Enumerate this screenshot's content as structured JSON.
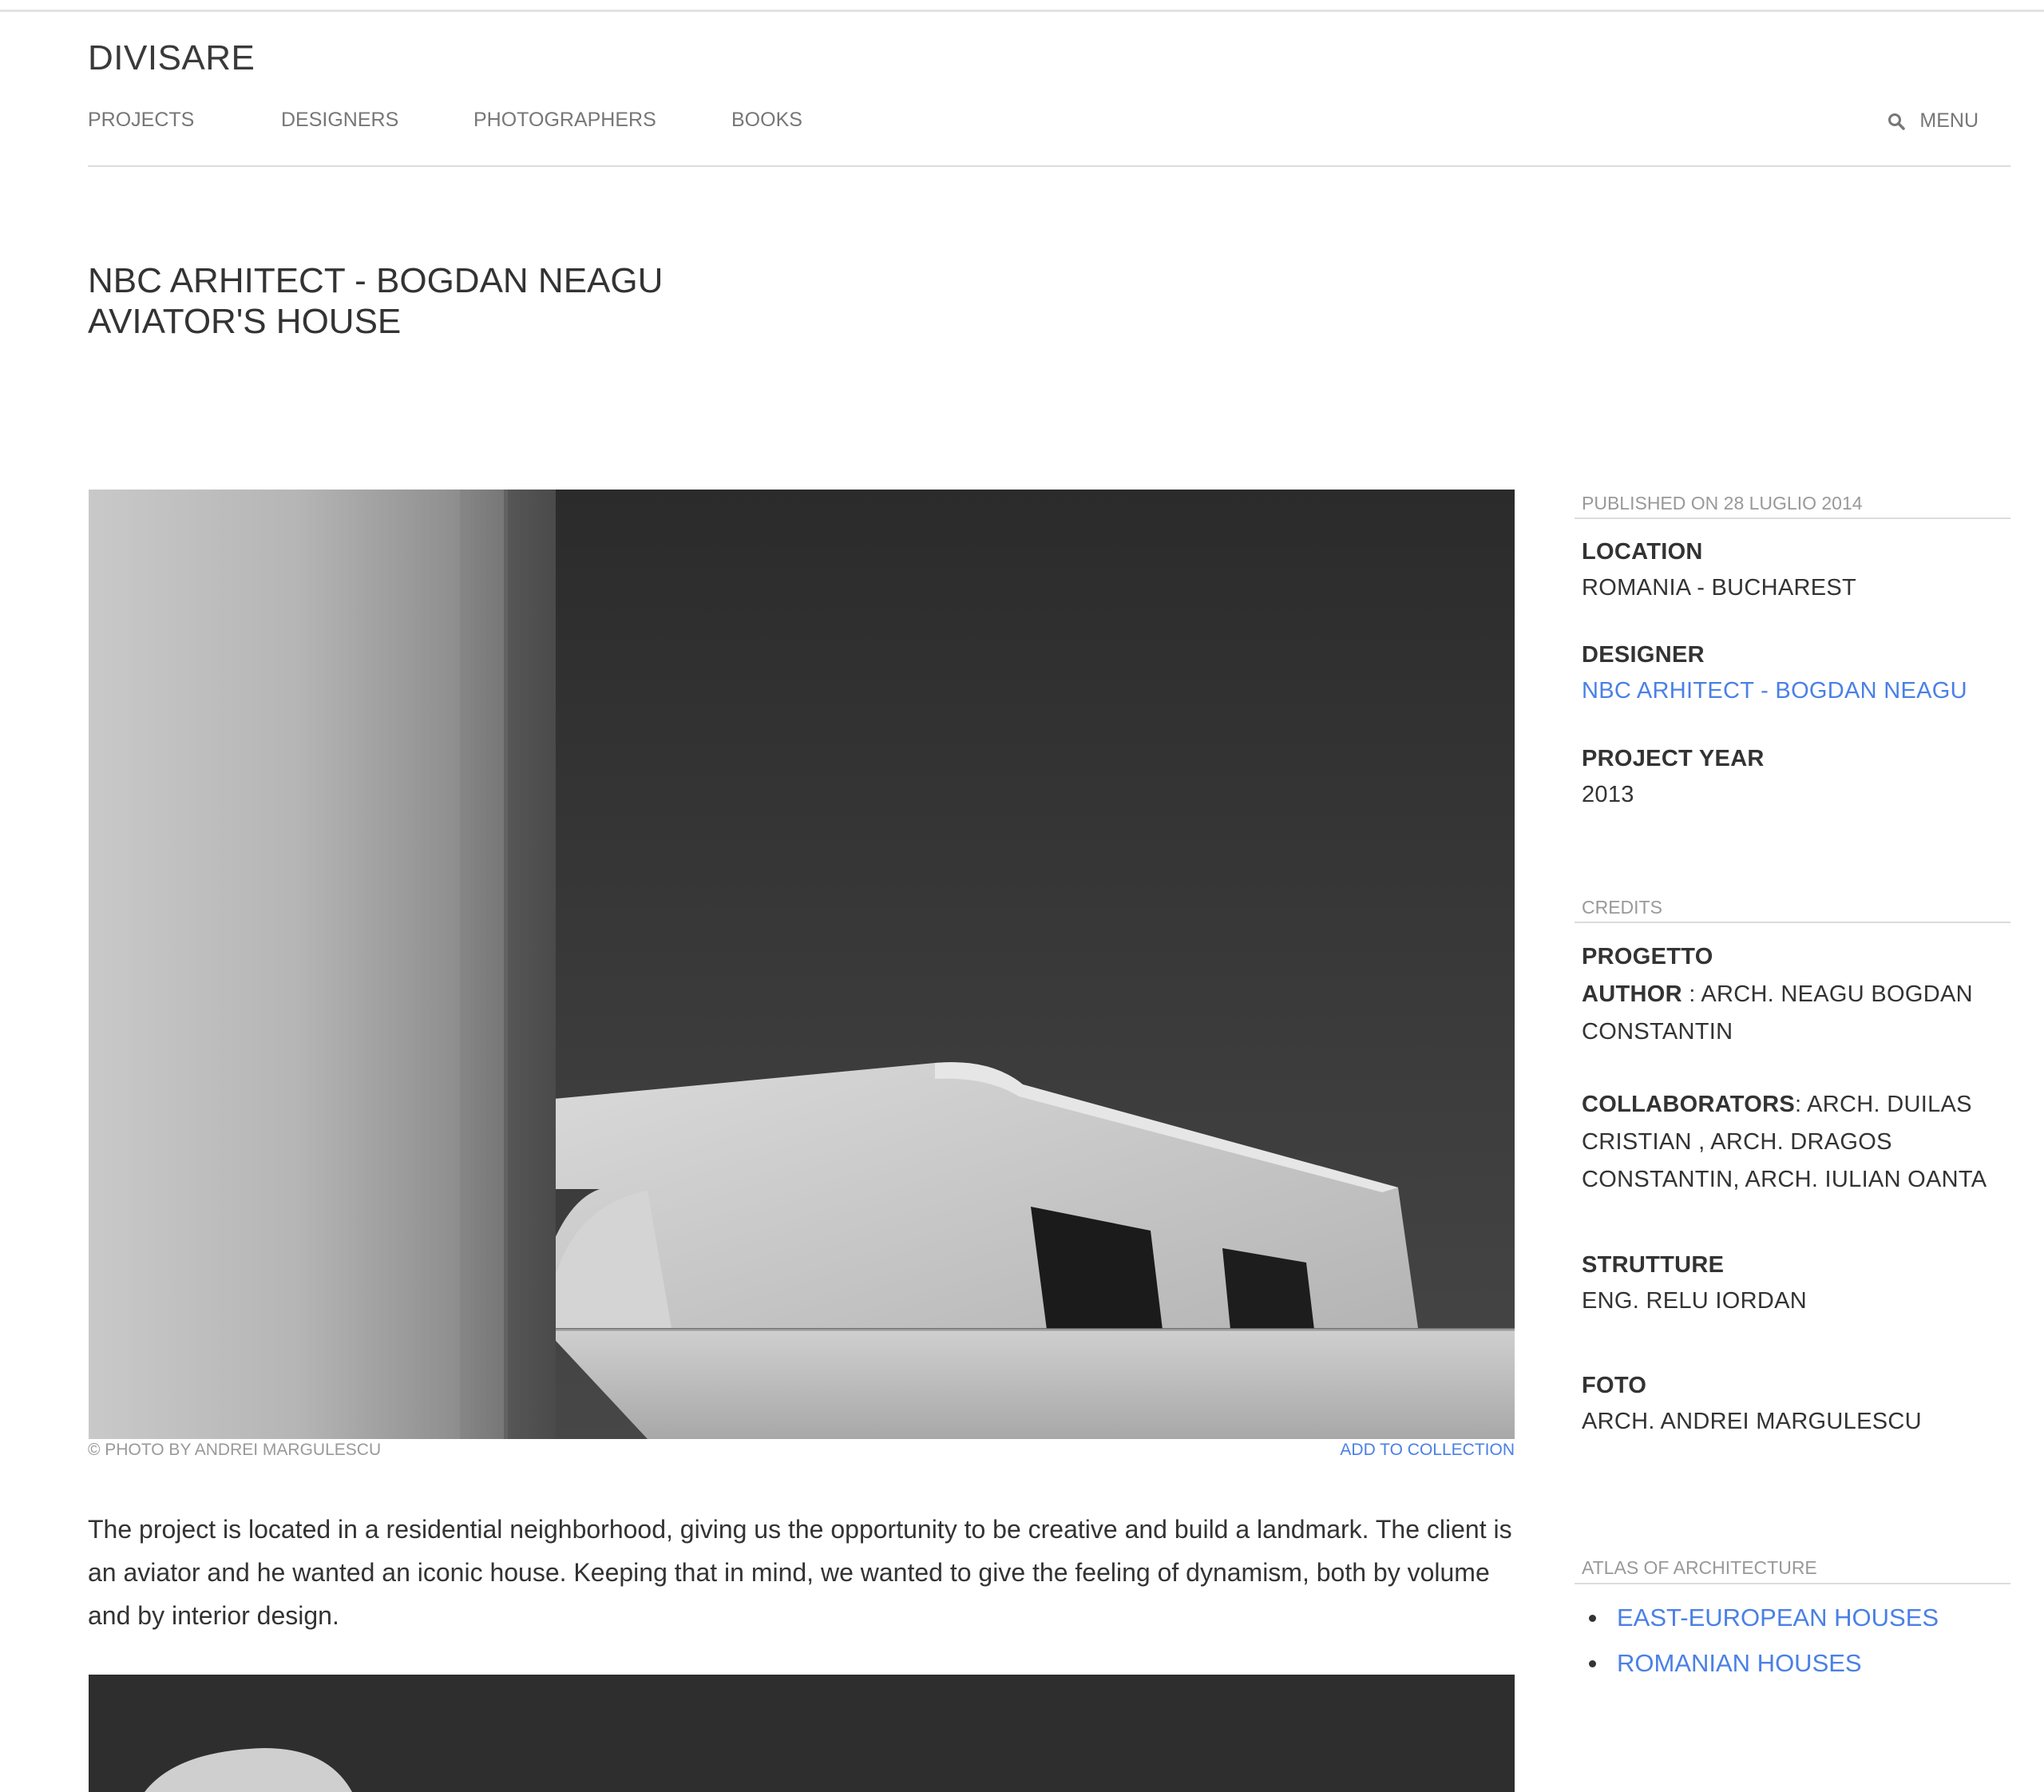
{
  "site": {
    "brand": "DIVISARE"
  },
  "nav": {
    "items": [
      {
        "label": "PROJECTS"
      },
      {
        "label": "DESIGNERS"
      },
      {
        "label": "PHOTOGRAPHERS"
      },
      {
        "label": "BOOKS"
      }
    ],
    "menu_label": "MENU"
  },
  "article": {
    "title_line1": "NBC ARHITECT - BOGDAN NEAGU",
    "title_line2": "AVIATOR'S HOUSE",
    "photo_credit": "© PHOTO BY ANDREI MARGULESCU",
    "add_to_collection": "ADD TO COLLECTION",
    "description": "The project is located in a residential neighborhood, giving us the opportunity to be creative and build a landmark. The client is an aviator and he wanted an iconic house. Keeping that in mind, we wanted to give the feeling of dynamism, both by volume and by interior design."
  },
  "sidebar": {
    "published": "PUBLISHED ON 28 LUGLIO 2014",
    "location_label": "LOCATION",
    "location_value": "ROMANIA - BUCHAREST",
    "designer_label": "DESIGNER",
    "designer_value": "NBC ARHITECT - BOGDAN NEAGU",
    "year_label": "PROJECT YEAR",
    "year_value": "2013",
    "credits_title": "CREDITS",
    "credits": {
      "progetto_label": "PROGETTO",
      "author_label": "AUTHOR",
      "author_value": " : ARCH. NEAGU BOGDAN CONSTANTIN",
      "collaborators_label": "COLLABORATORS",
      "collaborators_value": ": ARCH. DUILAS CRISTIAN , ARCH. DRAGOS CONSTANTIN, ARCH. IULIAN OANTA",
      "strutture_label": "STRUTTURE",
      "strutture_value": "ENG. RELU IORDAN",
      "foto_label": "FOTO",
      "foto_value": "ARCH. ANDREI MARGULESCU"
    },
    "atlas_title": "ATLAS OF ARCHITECTURE",
    "atlas_items": [
      {
        "label": "EAST-EUROPEAN HOUSES"
      },
      {
        "label": "ROMANIAN HOUSES"
      }
    ]
  },
  "colors": {
    "link": "#4a80e6",
    "text": "#333333",
    "muted": "#999999",
    "rule": "#dcdcdc"
  },
  "icons": {
    "search": "search-icon"
  }
}
